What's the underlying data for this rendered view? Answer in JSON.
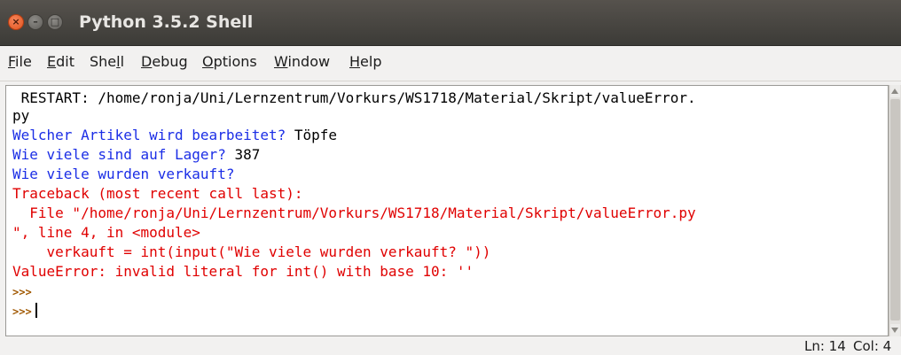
{
  "window": {
    "title": "Python 3.5.2 Shell",
    "buttons": {
      "close": "×",
      "minimize": "–",
      "maximize": "□"
    }
  },
  "menu": {
    "items": [
      {
        "label": "File",
        "mnemonic": "F",
        "rest": "ile"
      },
      {
        "label": "Edit",
        "mnemonic": "E",
        "rest": "dit"
      },
      {
        "label": "Shell",
        "pre": "She",
        "mnemonic": "l",
        "rest": "l"
      },
      {
        "label": "Debug",
        "mnemonic": "D",
        "rest": "ebug"
      },
      {
        "label": "Options",
        "mnemonic": "O",
        "rest": "ptions"
      },
      {
        "label": "Window",
        "mnemonic": "W",
        "rest": "indow"
      },
      {
        "label": "Help",
        "mnemonic": "H",
        "rest": "elp"
      }
    ]
  },
  "shell": {
    "restart_line": " RESTART: /home/ronja/Uni/Lernzentrum/Vorkurs/WS1718/Material/Skript/valueError.",
    "restart_line_cont": "py",
    "prompt1": "Welcher Artikel wird bearbeitet? ",
    "answer1": "Töpfe",
    "prompt2": "Wie viele sind auf Lager? ",
    "answer2": "387",
    "prompt3": "Wie viele wurden verkauft?",
    "traceback_header": "Traceback (most recent call last):",
    "traceback_file": "  File \"/home/ronja/Uni/Lernzentrum/Vorkurs/WS1718/Material/Skript/valueError.py",
    "traceback_file_cont": "\", line 4, in <module>",
    "traceback_code": "    verkauft = int(input(\"Wie viele wurden verkauft? \"))",
    "error": "ValueError: invalid literal for int() with base 10: ''",
    "prompt_marker": ">>>"
  },
  "status": {
    "line": "Ln: 14",
    "col": "Col: 4"
  },
  "colors": {
    "input_prompt": "#1b2ee6",
    "error": "#e00000",
    "user_text": "#000000",
    "shell_prompt": "#a05800"
  }
}
